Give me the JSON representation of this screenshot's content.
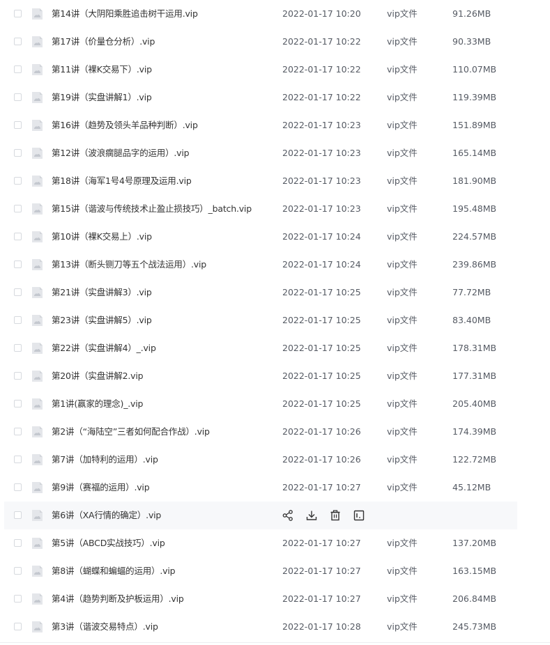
{
  "file_list": {
    "hover_actions": [
      {
        "name": "share-icon"
      },
      {
        "name": "download-icon"
      },
      {
        "name": "delete-icon"
      },
      {
        "name": "more-icon"
      }
    ],
    "rows": [
      {
        "name": "第14讲（大阴阳乘胜追击树干运用.vip",
        "time": "2022-01-17 10:20",
        "type": "vip文件",
        "size": "91.26MB"
      },
      {
        "name": "第17讲（价量仓分析）.vip",
        "time": "2022-01-17 10:22",
        "type": "vip文件",
        "size": "90.33MB"
      },
      {
        "name": "第11讲（裸K交易下）.vip",
        "time": "2022-01-17 10:22",
        "type": "vip文件",
        "size": "110.07MB"
      },
      {
        "name": "第19讲（实盘讲解1）.vip",
        "time": "2022-01-17 10:22",
        "type": "vip文件",
        "size": "119.39MB"
      },
      {
        "name": "第16讲（趋势及领头羊品种判断）.vip",
        "time": "2022-01-17 10:23",
        "type": "vip文件",
        "size": "151.89MB"
      },
      {
        "name": "第12讲（波浪瘸腿品字的运用）.vip",
        "time": "2022-01-17 10:23",
        "type": "vip文件",
        "size": "165.14MB"
      },
      {
        "name": "第18讲（海军1号4号原理及运用.vip",
        "time": "2022-01-17 10:23",
        "type": "vip文件",
        "size": "181.90MB"
      },
      {
        "name": "第15讲（谐波与传统技术止盈止损技巧）_batch.vip",
        "time": "2022-01-17 10:23",
        "type": "vip文件",
        "size": "195.48MB"
      },
      {
        "name": "第10讲（裸K交易上）.vip",
        "time": "2022-01-17 10:24",
        "type": "vip文件",
        "size": "224.57MB"
      },
      {
        "name": "第13讲（断头铡刀等五个战法运用）.vip",
        "time": "2022-01-17 10:24",
        "type": "vip文件",
        "size": "239.86MB"
      },
      {
        "name": "第21讲（实盘讲解3）.vip",
        "time": "2022-01-17 10:25",
        "type": "vip文件",
        "size": "77.72MB"
      },
      {
        "name": "第23讲（实盘讲解5）.vip",
        "time": "2022-01-17 10:25",
        "type": "vip文件",
        "size": "83.40MB"
      },
      {
        "name": "第22讲（实盘讲解4）_.vip",
        "time": "2022-01-17 10:25",
        "type": "vip文件",
        "size": "178.31MB"
      },
      {
        "name": "第20讲（实盘讲解2.vip",
        "time": "2022-01-17 10:25",
        "type": "vip文件",
        "size": "177.31MB"
      },
      {
        "name": "第1讲(赢家的理念)_.vip",
        "time": "2022-01-17 10:25",
        "type": "vip文件",
        "size": "205.40MB"
      },
      {
        "name": "第2讲（“海陆空”三者如何配合作战）.vip",
        "time": "2022-01-17 10:26",
        "type": "vip文件",
        "size": "174.39MB"
      },
      {
        "name": "第7讲（加特利的运用）.vip",
        "time": "2022-01-17 10:26",
        "type": "vip文件",
        "size": "122.72MB"
      },
      {
        "name": "第9讲（赛福的运用）.vip",
        "time": "2022-01-17 10:27",
        "type": "vip文件",
        "size": "45.12MB"
      },
      {
        "name": "第6讲（XA行情的确定）.vip",
        "time": "",
        "type": "",
        "size": "",
        "hovered": true
      },
      {
        "name": "第5讲（ABCD实战技巧）.vip",
        "time": "2022-01-17 10:27",
        "type": "vip文件",
        "size": "137.20MB"
      },
      {
        "name": "第8讲（蝴蝶和蝙蝠的运用）.vip",
        "time": "2022-01-17 10:27",
        "type": "vip文件",
        "size": "163.15MB"
      },
      {
        "name": "第4讲（趋势判断及护板运用）.vip",
        "time": "2022-01-17 10:27",
        "type": "vip文件",
        "size": "206.84MB"
      },
      {
        "name": "第3讲（谐波交易特点）.vip",
        "time": "2022-01-17 10:28",
        "type": "vip文件",
        "size": "245.73MB"
      }
    ]
  }
}
